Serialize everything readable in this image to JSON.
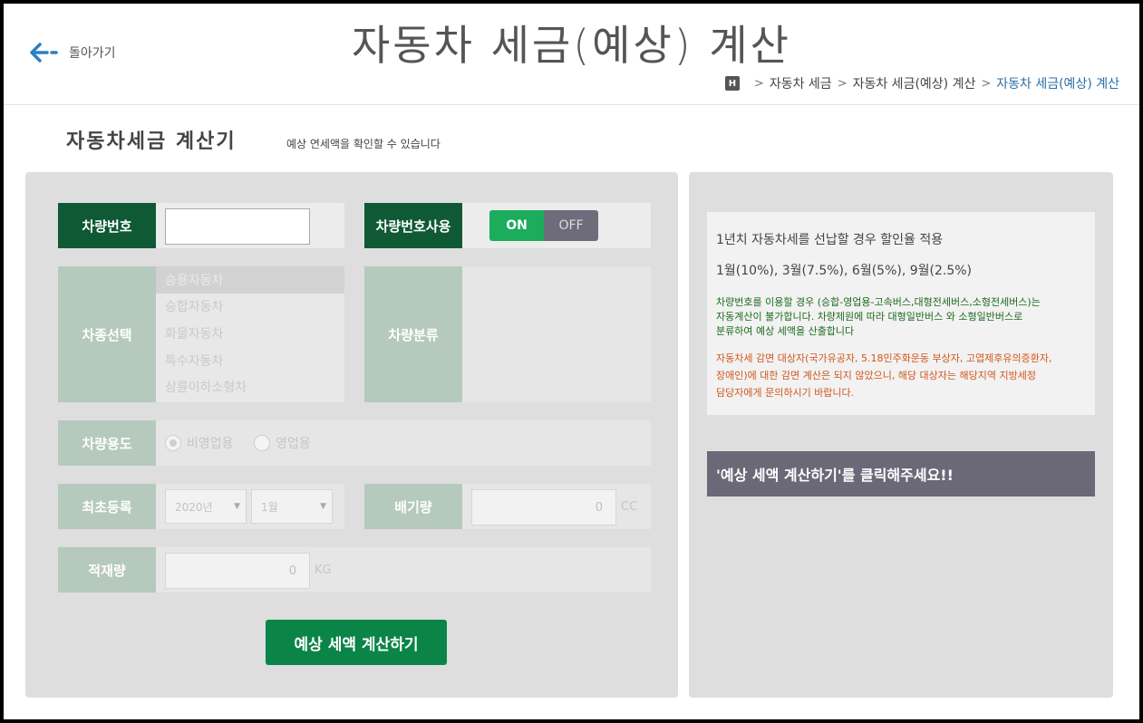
{
  "header": {
    "back_label": "돌아가기",
    "title": "자동차 세금(예상) 계산",
    "breadcrumb": {
      "home_icon": "H",
      "items": [
        "자동차 세금",
        "자동차 세금(예상) 계산"
      ],
      "current": "자동차 세금(예상) 계산"
    }
  },
  "section": {
    "title": "자동차세금 계산기",
    "subtitle": "예상 연세액을 확인할 수 있습니다"
  },
  "form": {
    "plate_label": "차량번호",
    "plate_value": "",
    "plate_use_label": "차량번호사용",
    "toggle": {
      "on": "ON",
      "off": "OFF",
      "state": "ON"
    },
    "car_type_label": "차종선택",
    "car_types": [
      "승용자동차",
      "승합자동차",
      "화물자동차",
      "특수자동차",
      "삼륜이하소형차"
    ],
    "car_type_selected": "승용자동차",
    "classify_label": "차량분류",
    "usage_label": "차량용도",
    "usage_options": [
      "비영업용",
      "영업용"
    ],
    "usage_selected": "비영업용",
    "first_reg_label": "최초등록",
    "year_value": "2020년",
    "month_value": "1월",
    "displacement_label": "배기량",
    "displacement_value": "0",
    "displacement_unit": "CC",
    "capacity_label": "적재량",
    "capacity_value": "0",
    "capacity_unit": "KG",
    "calc_button": "예상 세액 계산하기"
  },
  "info": {
    "line1": "1년치 자동차세를 선납할 경우 할인율 적용",
    "line2": "1월(10%), 3월(7.5%), 6월(5%), 9월(2.5%)",
    "green_lines": [
      "차량번호를 이용할 경우 (승합-영업용-고속버스,대형전세버스,소형전세버스)는",
      "자동계산이 불가합니다. 차량제원에 따라 대형일반버스 와 소형일반버스로",
      "분류하여 예상 세액을 산출합니다"
    ],
    "orange_lines": [
      "자동차세 감면 대상자(국가유공자, 5.18민주화운동 부상자, 고엽제후유의증환자,",
      "장애인)에 대한 감면 계산은 되지 않았으니, 해당 대상자는 해당지역 지방세정",
      "담당자에게 문의하시기 바랍니다."
    ],
    "result_prompt": "'예상 세액 계산하기'를 클릭해주세요!!"
  },
  "colors": {
    "label_active": "#0f5a34",
    "label_disabled": "#b6c9bd",
    "toggle_on": "#1bac5c",
    "toggle_off": "#6e6c7b",
    "button": "#0b8448",
    "result_bar": "#6b6878",
    "breadcrumb_current": "#2a6fa8"
  }
}
